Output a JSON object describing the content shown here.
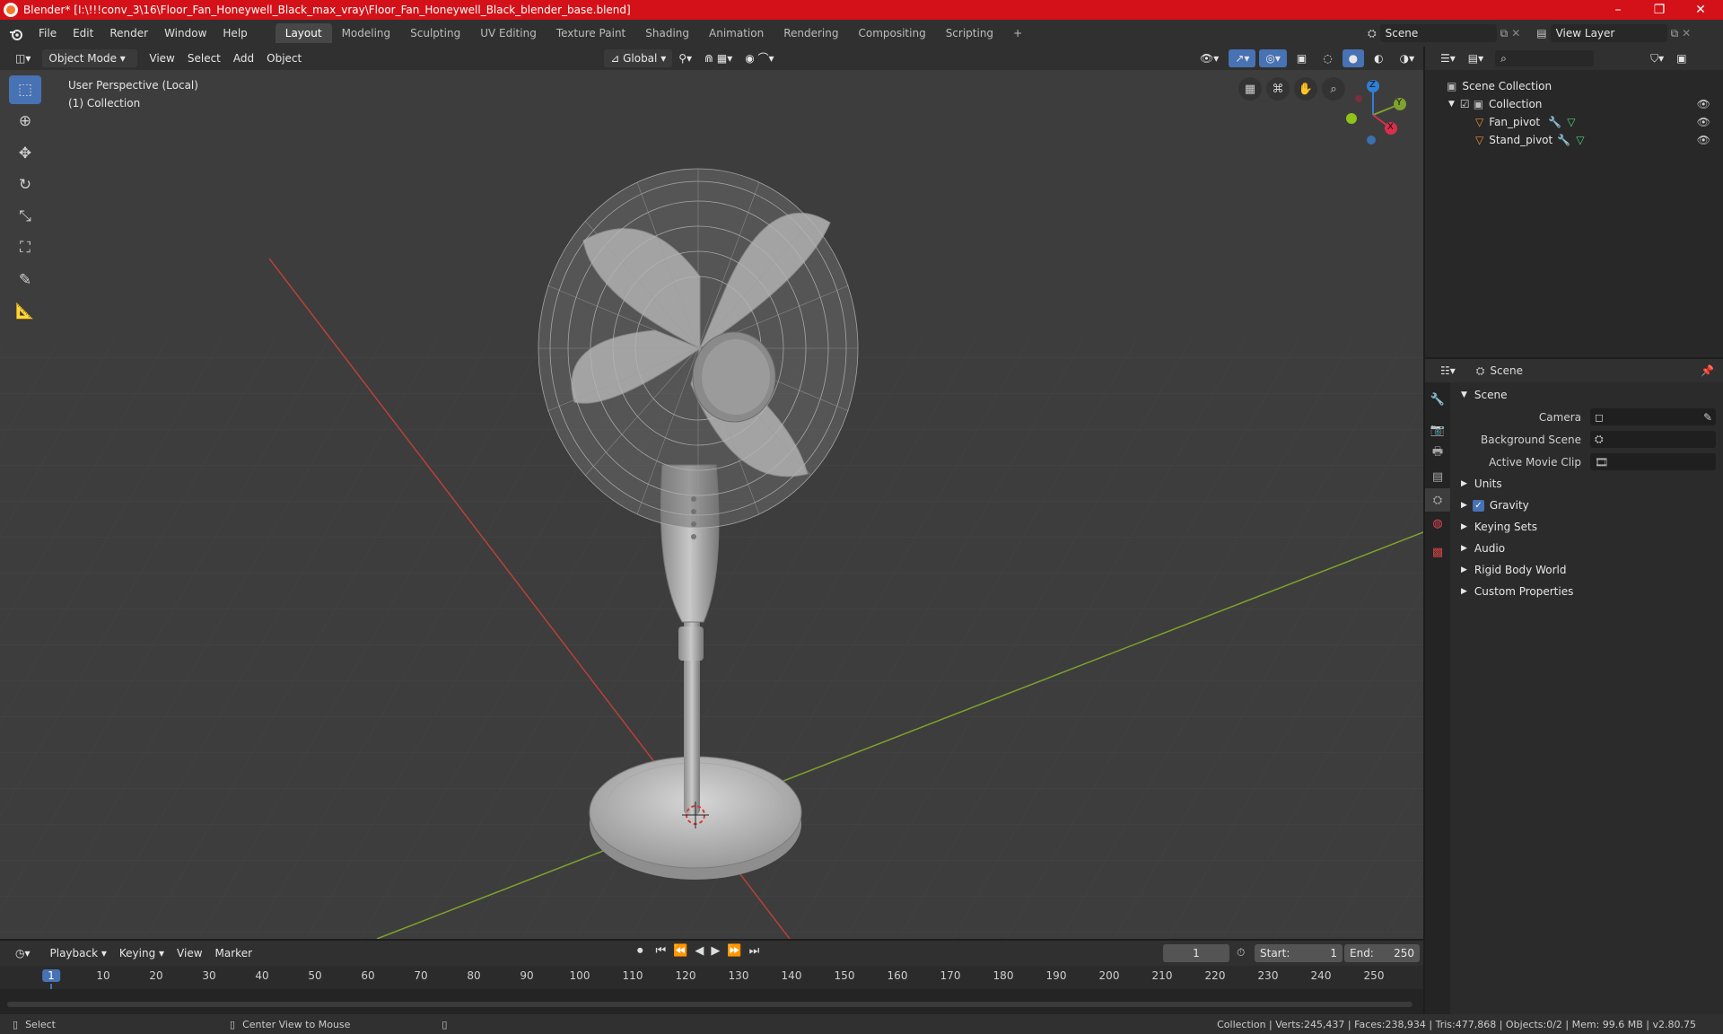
{
  "window": {
    "title": "Blender* [I:\\!!!conv_3\\16\\Floor_Fan_Honeywell_Black_max_vray\\Floor_Fan_Honeywell_Black_blender_base.blend]",
    "minimize": "–",
    "restore": "❐",
    "close": "✕"
  },
  "menu": {
    "items": [
      "File",
      "Edit",
      "Render",
      "Window",
      "Help"
    ],
    "workspaces": [
      "Layout",
      "Modeling",
      "Sculpting",
      "UV Editing",
      "Texture Paint",
      "Shading",
      "Animation",
      "Rendering",
      "Compositing",
      "Scripting"
    ],
    "add_workspace": "+",
    "scene_label": "Scene",
    "view_layer_label": "View Layer"
  },
  "viewport_header": {
    "mode": "Object Mode",
    "view": "View",
    "select": "Select",
    "add": "Add",
    "object": "Object",
    "orientation": "Global"
  },
  "viewport": {
    "perspective_label": "User Perspective (Local)",
    "collection_label": "(1) Collection",
    "gizmo": {
      "z": "Z",
      "y": "Y",
      "x": "X"
    }
  },
  "outliner": {
    "root": "Scene Collection",
    "collection": "Collection",
    "objects": [
      "Fan_pivot",
      "Stand_pivot"
    ],
    "search_placeholder": ""
  },
  "properties": {
    "context": "Scene",
    "section": "Scene",
    "camera_label": "Camera",
    "background_scene_label": "Background Scene",
    "active_movie_clip_label": "Active Movie Clip",
    "panels": [
      "Units",
      "Gravity",
      "Keying Sets",
      "Audio",
      "Rigid Body World",
      "Custom Properties"
    ],
    "gravity_checked": true
  },
  "timeline": {
    "playback": "Playback",
    "keying": "Keying",
    "view": "View",
    "marker": "Marker",
    "current_frame": "1",
    "start_label": "Start:",
    "start_value": "1",
    "end_label": "End:",
    "end_value": "250",
    "ticks": [
      "1",
      "10",
      "20",
      "30",
      "40",
      "50",
      "60",
      "70",
      "80",
      "90",
      "100",
      "110",
      "120",
      "130",
      "140",
      "150",
      "160",
      "170",
      "180",
      "190",
      "200",
      "210",
      "220",
      "230",
      "240",
      "250"
    ]
  },
  "status": {
    "select": "Select",
    "center_view": "Center View to Mouse",
    "stats": "Collection | Verts:245,437 | Faces:238,934 | Tris:477,868 | Objects:0/2 | Mem: 99.6 MB | v2.80.75"
  },
  "colors": {
    "titlebar": "#d41118",
    "accent": "#4772b3",
    "viewport_bg": "#3d3d3d",
    "axis_x": "#c0392b",
    "axis_y": "#7ea22e"
  }
}
